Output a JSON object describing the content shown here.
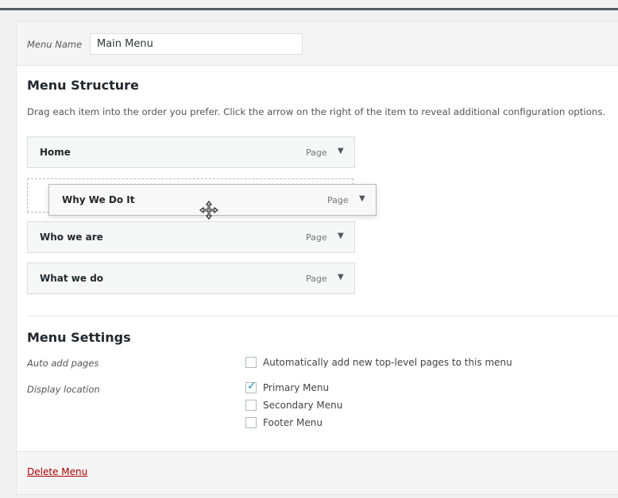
{
  "menu_name": {
    "label": "Menu Name",
    "value": "Main Menu"
  },
  "structure": {
    "title": "Menu Structure",
    "description": "Drag each item into the order you prefer. Click the arrow on the right of the item to reveal additional configuration options.",
    "items": [
      {
        "title": "Home",
        "type": "Page"
      },
      {
        "title": "Why We Do It",
        "type": "Page",
        "state": "dragging"
      },
      {
        "title": "Who we are",
        "type": "Page"
      },
      {
        "title": "What we do",
        "type": "Page"
      }
    ],
    "toggle_glyph": "▼"
  },
  "settings": {
    "title": "Menu Settings",
    "auto_add": {
      "label": "Auto add pages",
      "option": {
        "label": "Automatically add new top-level pages to this menu",
        "checked": false
      }
    },
    "display_location": {
      "label": "Display location",
      "options": [
        {
          "label": "Primary Menu",
          "checked": true
        },
        {
          "label": "Secondary Menu",
          "checked": false
        },
        {
          "label": "Footer Menu",
          "checked": false
        }
      ]
    }
  },
  "footer": {
    "delete_label": "Delete Menu"
  },
  "colors": {
    "accent": "#1e8cbe",
    "delete": "#aa0000"
  }
}
